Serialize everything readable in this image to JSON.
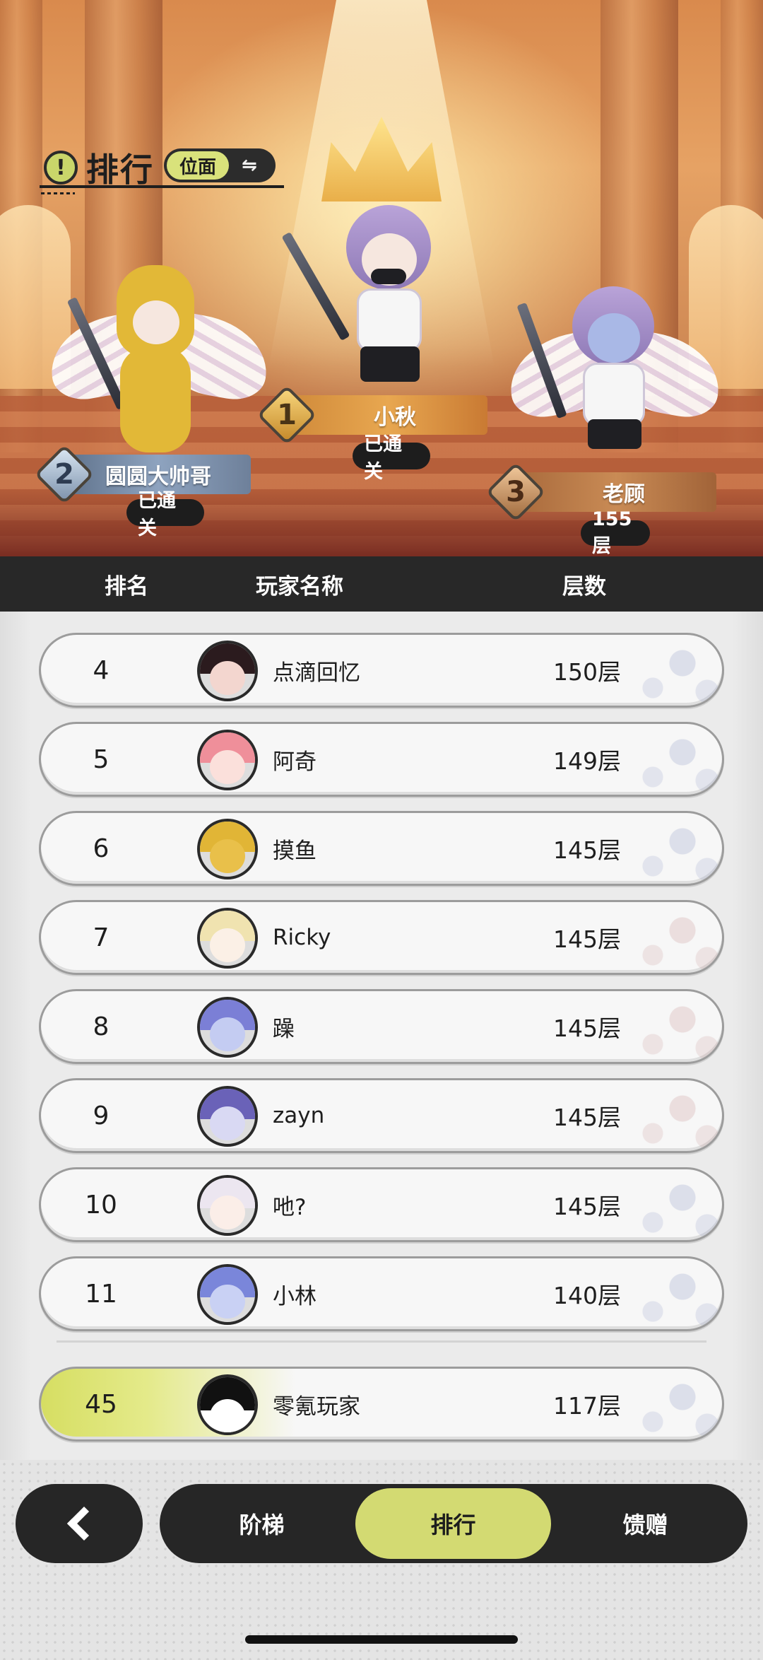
{
  "header": {
    "title": "排行",
    "scope_label": "位面",
    "switch_glyph": "⇋",
    "icons": [
      "info-icon",
      "switch-icon"
    ]
  },
  "podium": [
    {
      "rank": "1",
      "name": "小秋",
      "status": "已通关",
      "plate_color": "gold"
    },
    {
      "rank": "2",
      "name": "圆圆大帅哥",
      "status": "已通关",
      "plate_color": "silver"
    },
    {
      "rank": "3",
      "name": "老顾",
      "status": "155层",
      "plate_color": "bronze"
    }
  ],
  "table": {
    "headers": {
      "rank": "排名",
      "player": "玩家名称",
      "floors": "层数"
    },
    "rows": [
      {
        "rank": "4",
        "name": "点滴回忆",
        "floors": "150层"
      },
      {
        "rank": "5",
        "name": "阿奇",
        "floors": "149层"
      },
      {
        "rank": "6",
        "name": "摸鱼",
        "floors": "145层"
      },
      {
        "rank": "7",
        "name": "Ricky",
        "floors": "145层"
      },
      {
        "rank": "8",
        "name": "躁",
        "floors": "145层"
      },
      {
        "rank": "9",
        "name": "zayn",
        "floors": "145层"
      },
      {
        "rank": "10",
        "name": "吔?",
        "floors": "145层"
      },
      {
        "rank": "11",
        "name": "小林",
        "floors": "140层"
      }
    ],
    "self": {
      "rank": "45",
      "name": "零氪玩家",
      "floors": "117层"
    }
  },
  "nav": {
    "back_icon": "chevron-left-icon",
    "tabs": [
      {
        "label": "阶梯",
        "active": false
      },
      {
        "label": "排行",
        "active": true
      },
      {
        "label": "馈赠",
        "active": false
      }
    ]
  },
  "colors": {
    "accent": "#d3da72",
    "dark": "#262626",
    "header_bg": "#282828"
  }
}
